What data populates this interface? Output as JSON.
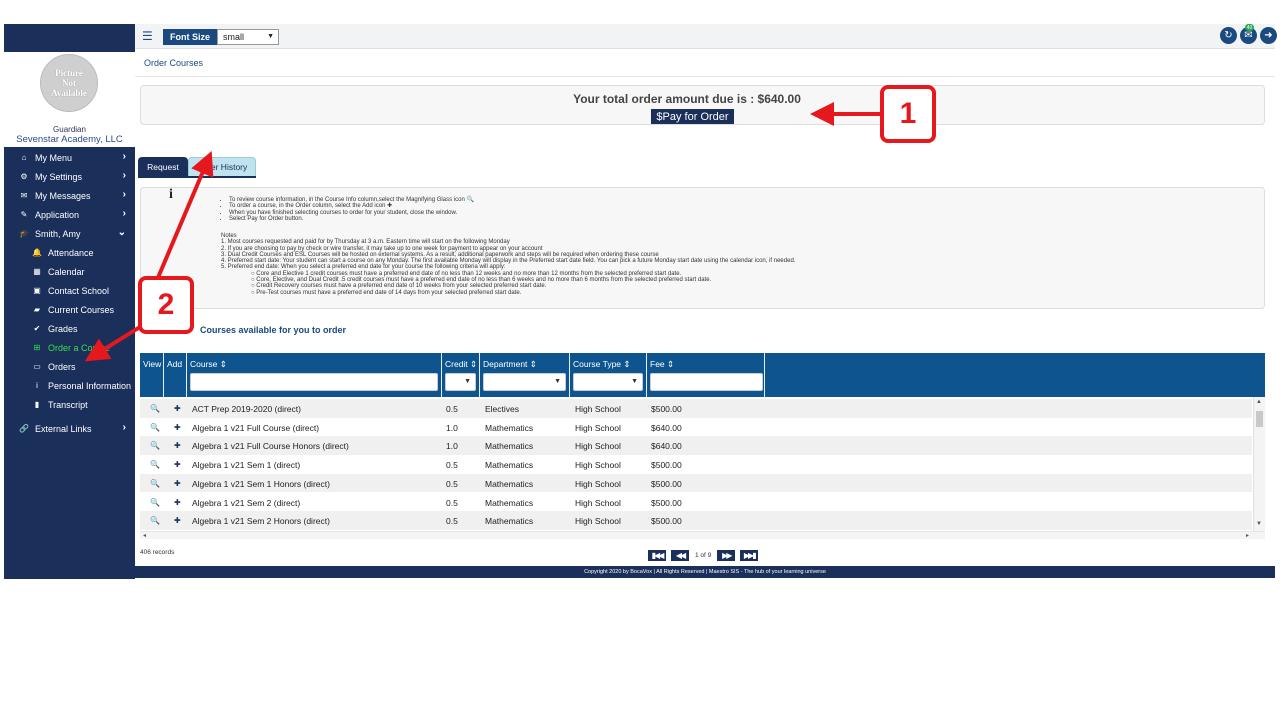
{
  "toolbar": {
    "menu_icon": "hamburger-icon",
    "font_size_label": "Font Size",
    "font_size_value": "small",
    "refresh_icon": "refresh-icon",
    "mail_icon": "mail-icon",
    "mail_badge": "40",
    "logout_icon": "logout-icon"
  },
  "profile": {
    "avatar_line1": "Picture",
    "avatar_line2": "Not",
    "avatar_line3": "Available",
    "role": "Guardian",
    "school": "Sevenstar Academy, LLC"
  },
  "sidebar": {
    "items": [
      {
        "label": "My Menu",
        "icon": "home-icon",
        "chevron": "›"
      },
      {
        "label": "My Settings",
        "icon": "gears-icon",
        "chevron": "›"
      },
      {
        "label": "My Messages",
        "icon": "chat-icon",
        "chevron": "›"
      },
      {
        "label": "Application",
        "icon": "edit-icon",
        "chevron": "›"
      },
      {
        "label": "Smith, Amy",
        "icon": "graduation-cap-icon",
        "chevron": "⌄"
      },
      {
        "label": "Attendance",
        "icon": "bell-icon"
      },
      {
        "label": "Calendar",
        "icon": "calendar-icon"
      },
      {
        "label": "Contact School",
        "icon": "address-card-icon"
      },
      {
        "label": "Current Courses",
        "icon": "book-icon"
      },
      {
        "label": "Grades",
        "icon": "check-icon"
      },
      {
        "label": "Order a Course",
        "icon": "plus-square-icon"
      },
      {
        "label": "Orders",
        "icon": "credit-card-icon"
      },
      {
        "label": "Personal Information",
        "icon": "info-icon"
      },
      {
        "label": "Transcript",
        "icon": "file-icon"
      },
      {
        "label": "External Links",
        "icon": "link-icon",
        "chevron": "›"
      }
    ]
  },
  "breadcrumb": "Order Courses",
  "order": {
    "total_text": "Your total order amount due is : $640.00",
    "pay_button": "$Pay for Order"
  },
  "tabs": {
    "request": "Request",
    "history": "Order History"
  },
  "instructions": {
    "bullets": [
      "To review course information, in the Course Info column,select the Magnifying Glass icon 🔍",
      "To order a course, in the Order column, select the Add icon ✚",
      "When you have finished selecting courses to order for your student, close the window.",
      "Select Pay for Order button."
    ],
    "notes_title": "Notes",
    "notes": [
      "1. Most courses requested and paid for by Thursday at 3 a.m. Eastern time will start on the following Monday",
      "2. If you are choosing to pay by check or wire transfer, it may take up to one week for payment to appear on your account",
      "3. Dual Credit Courses and ESL Courses will be hosted on external systems. As a result, additional paperwork and steps will be required when ordering these course",
      "4. Preferred start date: Your student can start a course on any Monday. The first available Monday will display in the Preferred start date field. You can pick a future Monday start date using the calendar icon, if needed.",
      "5. Preferred end date: When you select a preferred end date for your course the following criteria will apply:"
    ],
    "criteria": [
      "Core and Elective 1 credit courses must have a preferred end date of no less than 12 weeks and no more than 12 months from the selected preferred start date.",
      "Core, Elective, and Dual Credit .5 credit courses must have a preferred end date of no less than 6 weeks and no more than 6 months from the selected preferred start date.",
      "Credit Recovery courses must have a preferred end date of 10 weeks from your selected preferred start date.",
      "Pre-Test courses must have a preferred end date of 14 days from your selected preferred start date."
    ]
  },
  "available_title": "Courses available for you to order",
  "grid": {
    "columns": [
      "View",
      "Add",
      "Course ⇕",
      "Credit ⇕",
      "Department ⇕",
      "Course Type ⇕",
      "Fee ⇕"
    ],
    "rows": [
      {
        "course": "ACT Prep 2019-2020 (direct)",
        "credit": "0.5",
        "department": "Electives",
        "type": "High School",
        "fee": "$500.00"
      },
      {
        "course": "Algebra 1 v21 Full Course (direct)",
        "credit": "1.0",
        "department": "Mathematics",
        "type": "High School",
        "fee": "$640.00"
      },
      {
        "course": "Algebra 1 v21 Full Course Honors (direct)",
        "credit": "1.0",
        "department": "Mathematics",
        "type": "High School",
        "fee": "$640.00"
      },
      {
        "course": "Algebra 1 v21 Sem 1 (direct)",
        "credit": "0.5",
        "department": "Mathematics",
        "type": "High School",
        "fee": "$500.00"
      },
      {
        "course": "Algebra 1 v21 Sem 1 Honors (direct)",
        "credit": "0.5",
        "department": "Mathematics",
        "type": "High School",
        "fee": "$500.00"
      },
      {
        "course": "Algebra 1 v21 Sem 2 (direct)",
        "credit": "0.5",
        "department": "Mathematics",
        "type": "High School",
        "fee": "$500.00"
      },
      {
        "course": "Algebra 1 v21 Sem 2 Honors (direct)",
        "credit": "0.5",
        "department": "Mathematics",
        "type": "High School",
        "fee": "$500.00"
      }
    ],
    "records": "406 records",
    "page_info": "1 of 9"
  },
  "footer": "Copyright 2020 by BocaVox | All Rights Reserved | Maestro SIS - The hub of your learning universe",
  "callouts": {
    "one": "1",
    "two": "2"
  },
  "colors": {
    "navy": "#1a2f5a",
    "grid_header": "#0e5590",
    "active_green": "#37e04f",
    "callout_red": "#e4181d"
  }
}
